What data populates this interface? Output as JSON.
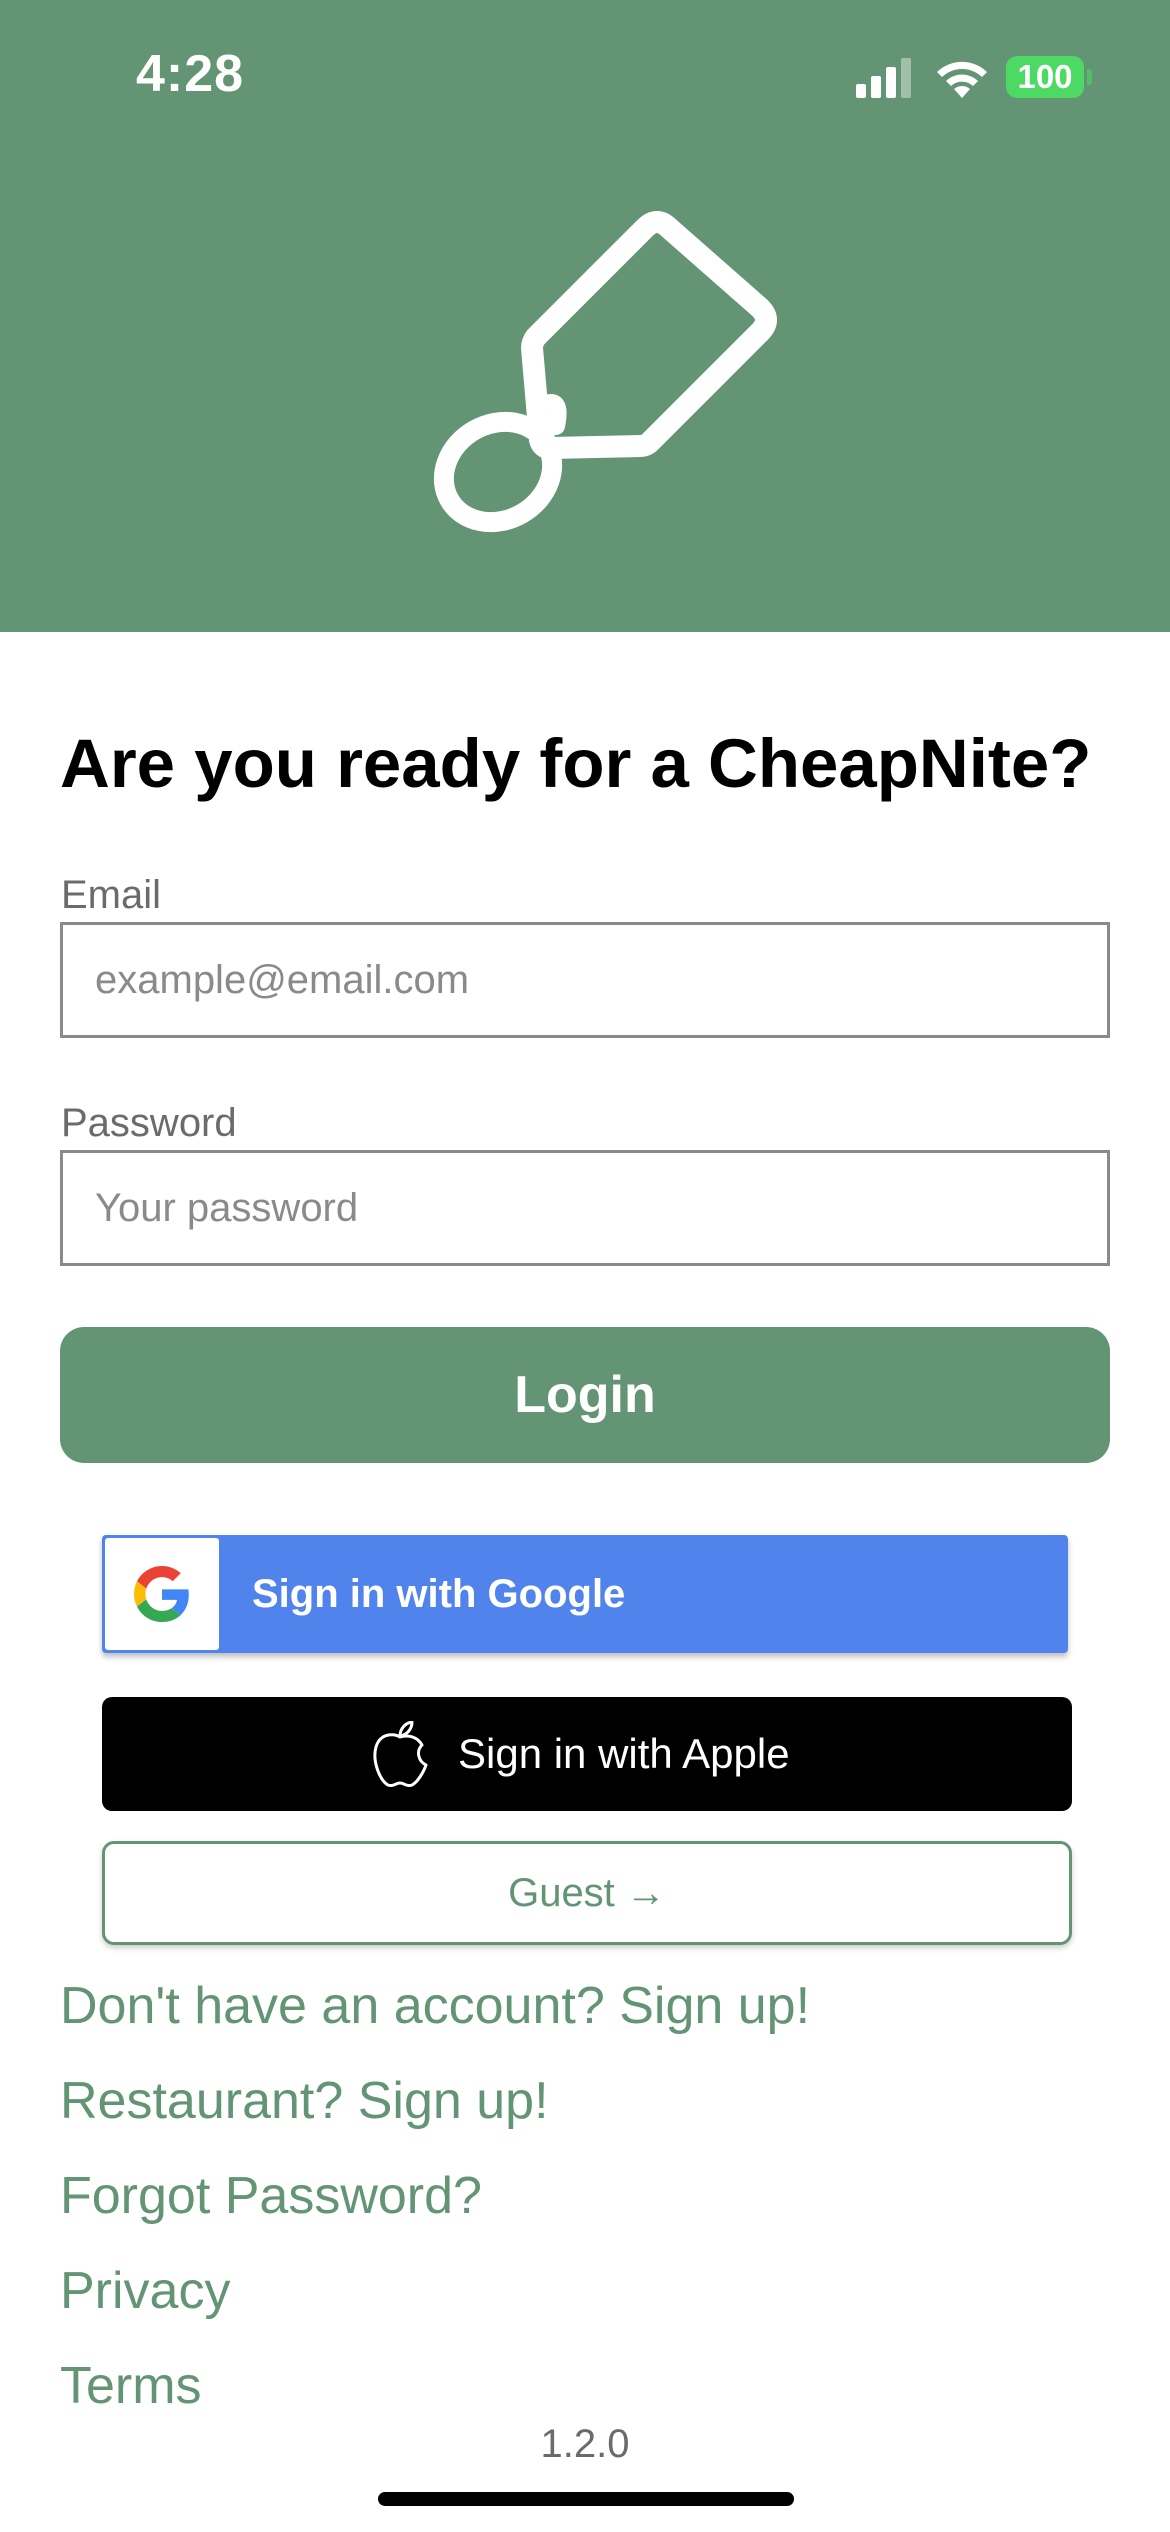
{
  "status_bar": {
    "time": "4:28",
    "battery": "100"
  },
  "login": {
    "headline": "Are you ready for a CheapNite?",
    "email_label": "Email",
    "email_placeholder": "example@email.com",
    "email_value": "",
    "password_label": "Password",
    "password_placeholder": "Your password",
    "password_value": "",
    "login_button": "Login"
  },
  "social": {
    "google_label": "Sign in with Google",
    "apple_label": "Sign in with Apple",
    "guest_label": "Guest →"
  },
  "links": [
    "Don't have an account? Sign up!",
    "Restaurant? Sign up!",
    "Forgot Password?",
    "Privacy",
    "Terms"
  ],
  "version": "1.2.0",
  "colors": {
    "brand_green": "#639474",
    "google_blue": "#5183ec",
    "battery_green": "#4cd964"
  },
  "icons": [
    "signal-icon",
    "wifi-icon",
    "battery-icon",
    "price-tag-logo",
    "google-g-icon",
    "apple-icon",
    "arrow-right-icon"
  ]
}
